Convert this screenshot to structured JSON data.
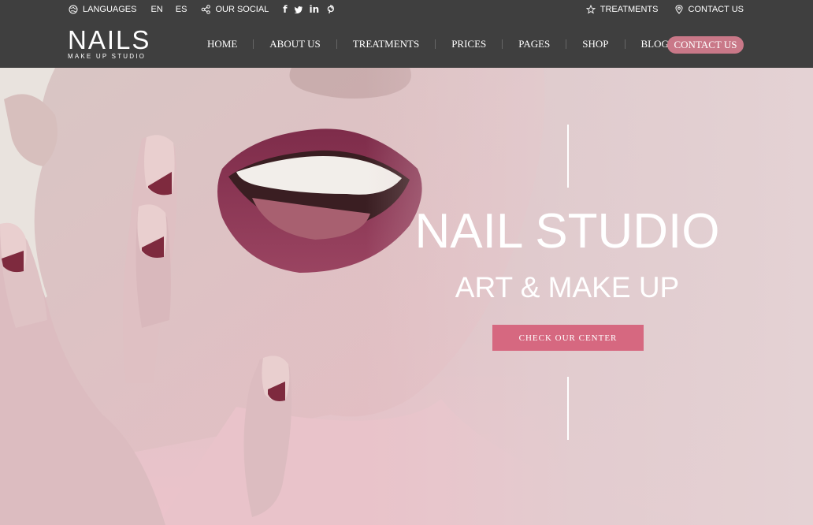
{
  "topbar": {
    "languages_label": "LANGUAGES",
    "lang_en": "EN",
    "lang_es": "ES",
    "social_label": "OUR SOCIAL",
    "social_icons": [
      "facebook-icon",
      "twitter-icon",
      "linkedin-icon",
      "pinterest-icon"
    ],
    "treatments_label": "TREATMENTS",
    "contact_label": "CONTACT US"
  },
  "logo": {
    "title": "NAILS",
    "subtitle": "MAKE UP STUDIO"
  },
  "nav": {
    "items": [
      "HOME",
      "ABOUT US",
      "TREATMENTS",
      "PRICES",
      "PAGES",
      "SHOP",
      "BLOG"
    ],
    "cta": "CONTACT US"
  },
  "hero": {
    "title": "NAIL STUDIO",
    "subtitle": "ART & MAKE UP",
    "button": "CHECK OUR CENTER"
  },
  "colors": {
    "bar_bg": "#3f3f3f",
    "accent_pill": "#c97888",
    "cta_bg": "#d66880",
    "lips": "#8a3452"
  }
}
